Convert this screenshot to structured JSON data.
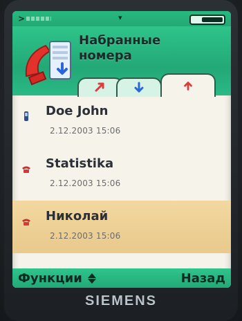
{
  "header": {
    "title_line1": "Набранные",
    "title_line2": "номера"
  },
  "calls": [
    {
      "name": "Doe John",
      "datetime": "2.12.2003 15:06",
      "icon": "mobile-phone-icon",
      "selected": false
    },
    {
      "name": "Statistika",
      "datetime": "2.12.2003 15:06",
      "icon": "home-phone-icon",
      "selected": false
    },
    {
      "name": "Николай",
      "datetime": "2.12.2003 15:06",
      "icon": "home-phone-icon",
      "selected": true
    }
  ],
  "softkeys": {
    "left": "Функции",
    "right": "Назад"
  },
  "brand": "SIEMENS",
  "colors": {
    "accent_green": "#26b980",
    "selected_bg": "#ecd095",
    "list_bg": "#f6f3ea",
    "text_dark": "#2b2f36",
    "tab_icon_red": "#e03a3a",
    "tab_icon_blue": "#2a66d9"
  }
}
